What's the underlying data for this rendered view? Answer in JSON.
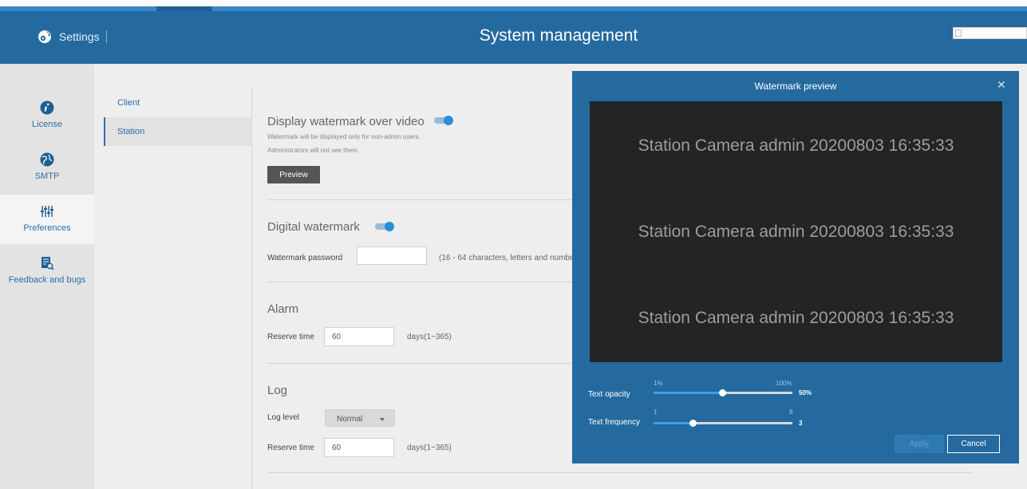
{
  "header": {
    "settings_label": "Settings",
    "title": "System management"
  },
  "nav": {
    "items": [
      {
        "label": "License",
        "icon": "info-icon"
      },
      {
        "label": "SMTP",
        "icon": "globe-icon"
      },
      {
        "label": "Preferences",
        "icon": "sliders-icon"
      },
      {
        "label": "Feedback and bugs",
        "icon": "feedback-icon"
      }
    ]
  },
  "subnav": {
    "items": [
      "Client",
      "Station"
    ],
    "active": "Station"
  },
  "display_watermark": {
    "title": "Display watermark over video",
    "enabled": true,
    "note_1": "Watermark will be displayed only for non-admin users.",
    "note_2": "Administrators will not see them.",
    "preview_button": "Preview"
  },
  "digital_watermark": {
    "title": "Digital watermark",
    "enabled": true,
    "password_label": "Watermark password",
    "password_value": "",
    "password_hint": "(16 - 64 characters, letters and numbe"
  },
  "alarm": {
    "title": "Alarm",
    "reserve_label": "Reserve time",
    "reserve_value": "60",
    "reserve_unit": "days(1~365)"
  },
  "log": {
    "title": "Log",
    "level_label": "Log level",
    "level_value": "Normal",
    "reserve_label": "Reserve time",
    "reserve_value": "60",
    "reserve_unit": "days(1~365)"
  },
  "modal": {
    "title": "Watermark preview",
    "watermark_lines": [
      "Station Camera admin 20200803 16:35:33",
      "Station Camera admin 20200803 16:35:33",
      "Station Camera admin 20200803 16:35:33"
    ],
    "opacity": {
      "label": "Text opacity",
      "min_label": "1%",
      "max_label": "100%",
      "value_label": "50%",
      "min": 1,
      "max": 100,
      "value": 50
    },
    "frequency": {
      "label": "Text frequency",
      "min_label": "1",
      "max_label": "8",
      "value_label": "3",
      "min": 1,
      "max": 8,
      "value": 3
    },
    "apply_label": "Apply",
    "cancel_label": "Cancel"
  },
  "colors": {
    "header_blue": "#246a9f",
    "accent_blue": "#2b8ed9",
    "link_blue": "#2b6ea8"
  }
}
